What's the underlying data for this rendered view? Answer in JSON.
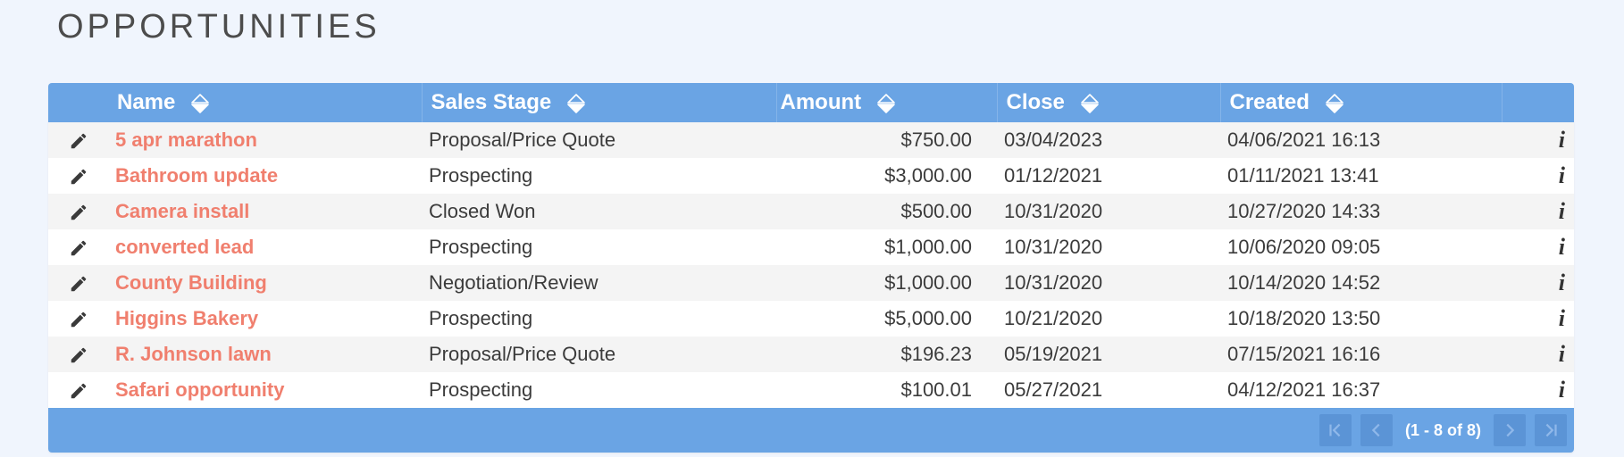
{
  "page": {
    "title": "OPPORTUNITIES"
  },
  "table": {
    "columns": [
      {
        "label": "Name",
        "sortable": true
      },
      {
        "label": "Sales Stage",
        "sortable": true
      },
      {
        "label": "Amount",
        "sortable": true
      },
      {
        "label": "Close",
        "sortable": true
      },
      {
        "label": "Created",
        "sortable": true
      }
    ],
    "rows": [
      {
        "name": "5 apr marathon",
        "stage": "Proposal/Price Quote",
        "amount": "$750.00",
        "close": "03/04/2023",
        "created": "04/06/2021 16:13"
      },
      {
        "name": "Bathroom update",
        "stage": "Prospecting",
        "amount": "$3,000.00",
        "close": "01/12/2021",
        "created": "01/11/2021 13:41"
      },
      {
        "name": "Camera install",
        "stage": "Closed Won",
        "amount": "$500.00",
        "close": "10/31/2020",
        "created": "10/27/2020 14:33"
      },
      {
        "name": "converted lead",
        "stage": "Prospecting",
        "amount": "$1,000.00",
        "close": "10/31/2020",
        "created": "10/06/2020 09:05"
      },
      {
        "name": "County Building",
        "stage": "Negotiation/Review",
        "amount": "$1,000.00",
        "close": "10/31/2020",
        "created": "10/14/2020 14:52"
      },
      {
        "name": "Higgins Bakery",
        "stage": "Prospecting",
        "amount": "$5,000.00",
        "close": "10/21/2020",
        "created": "10/18/2020 13:50"
      },
      {
        "name": "R. Johnson lawn",
        "stage": "Proposal/Price Quote",
        "amount": "$196.23",
        "close": "05/19/2021",
        "created": "07/15/2021 16:16"
      },
      {
        "name": "Safari opportunity",
        "stage": "Prospecting",
        "amount": "$100.01",
        "close": "05/27/2021",
        "created": "04/12/2021 16:37"
      }
    ],
    "row_icons": {
      "edit": "pencil-icon",
      "info": "i"
    }
  },
  "pagination": {
    "summary": "(1 - 8 of 8)",
    "buttons": [
      "first-page-icon",
      "previous-page-icon",
      "next-page-icon",
      "last-page-icon"
    ]
  },
  "colors": {
    "header": "#6aa4e4",
    "link": "#f07f6e",
    "background": "#f0f5fd"
  }
}
